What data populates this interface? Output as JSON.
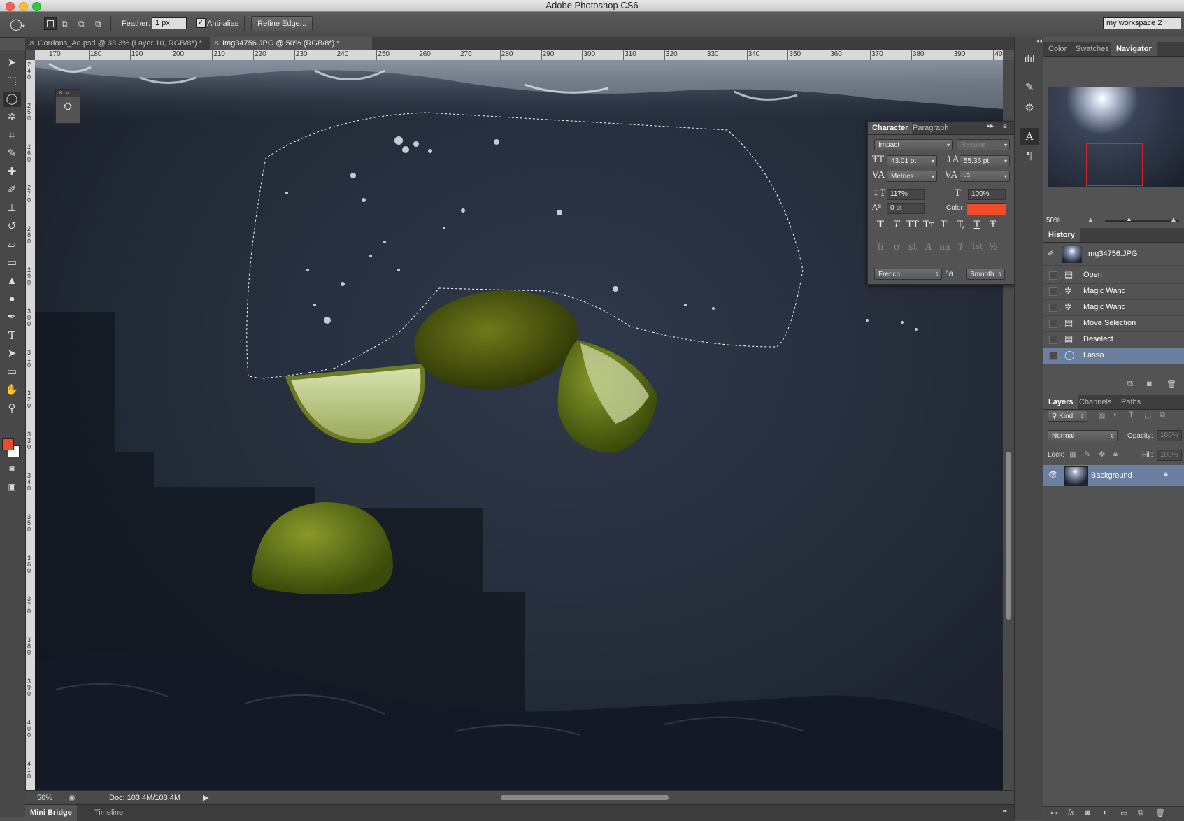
{
  "window": {
    "title": "Adobe Photoshop CS6",
    "workspace": "my workspace 2"
  },
  "options": {
    "feather_label": "Feather:",
    "feather_value": "1 px",
    "antialias_label": "Anti-alias",
    "refine_edge": "Refine Edge..."
  },
  "doc_tabs": [
    {
      "label": "Gordons_Ad.psd @ 33.3% (Layer 10, RGB/8*) *"
    },
    {
      "label": "Img34756.JPG @ 50% (RGB/8*) *"
    }
  ],
  "ruler_h": [
    "170",
    "180",
    "190",
    "200",
    "210",
    "220",
    "230",
    "240",
    "250",
    "260",
    "270",
    "280",
    "290",
    "300",
    "310",
    "320",
    "330",
    "340",
    "350",
    "360",
    "370",
    "380",
    "390",
    "40"
  ],
  "ruler_v": [
    "2 4 0",
    "2 5 0",
    "2 6 0",
    "2 7 0",
    "2 8 0",
    "2 9 0",
    "3 0 0",
    "3 1 0",
    "3 2 0",
    "3 3 0",
    "3 4 0",
    "3 5 0",
    "3 6 0",
    "3 7 0",
    "3 8 0",
    "3 9 0",
    "4 0 0",
    "4 1 0"
  ],
  "colors": {
    "foreground": "#f04a28",
    "background": "#ffffff",
    "text_color": "#f04a28",
    "selection": "#6b7fa0"
  },
  "status": {
    "zoom": "50%",
    "doc": "Doc: 103.4M/103.4M"
  },
  "bottom_tabs": [
    "Mini Bridge",
    "Timeline"
  ],
  "character": {
    "tabs": [
      "Character",
      "Paragraph"
    ],
    "font_family": "Impact",
    "font_style": "Regular",
    "size": "43.01 pt",
    "leading": "55.36 pt",
    "kerning": "Metrics",
    "tracking": "-9",
    "vscale": "117%",
    "hscale": "100%",
    "baseline": "0 pt",
    "color_label": "Color:",
    "type_styles": [
      "T",
      "T",
      "TT",
      "Tт",
      "T'",
      "T,",
      "T",
      "Ŧ"
    ],
    "opentype": [
      "fi",
      "ơ",
      "st",
      "A",
      "aa",
      "T",
      "1st",
      "½"
    ],
    "language": "French",
    "aa_icon": "ªa",
    "antialias": "Smooth"
  },
  "panel_top": {
    "tabs": [
      "Color",
      "Swatches",
      "Navigator"
    ],
    "nav_zoom": "50%"
  },
  "history": {
    "title": "History",
    "snapshot": "Img34756.JPG",
    "items": [
      {
        "label": "Open",
        "icon": "document-icon"
      },
      {
        "label": "Magic Wand",
        "icon": "magic-wand-icon"
      },
      {
        "label": "Magic Wand",
        "icon": "magic-wand-icon"
      },
      {
        "label": "Move Selection",
        "icon": "document-icon"
      },
      {
        "label": "Deselect",
        "icon": "document-icon"
      },
      {
        "label": "Lasso",
        "icon": "lasso-icon",
        "selected": true
      }
    ]
  },
  "layers": {
    "tabs": [
      "Layers",
      "Channels",
      "Paths"
    ],
    "kind": "Kind",
    "blend": "Normal",
    "opacity_label": "Opacity:",
    "opacity": "100%",
    "lock_label": "Lock:",
    "fill_label": "Fill:",
    "fill": "100%",
    "items": [
      {
        "name": "Background",
        "locked": true
      }
    ]
  }
}
